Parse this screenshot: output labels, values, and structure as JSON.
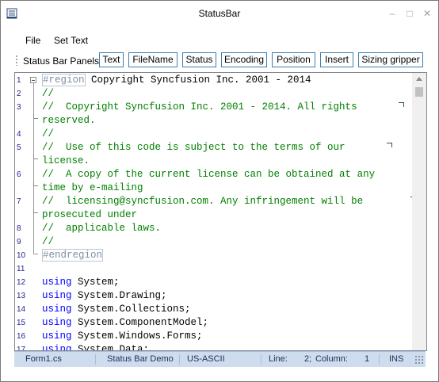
{
  "window": {
    "title": "StatusBar",
    "app_icon": "window-icon"
  },
  "window_buttons": {
    "minimize": "–",
    "maximize": "□",
    "close": "✕"
  },
  "menu": {
    "file": "File",
    "set_text": "Set Text"
  },
  "toolbar": {
    "label": "Status Bar Panels:",
    "buttons": [
      "Text",
      "FileName",
      "Status",
      "Encoding",
      "Position",
      "Insert",
      "Sizing gripper"
    ]
  },
  "editor": {
    "line_numbers": [
      "1",
      "2",
      "3",
      "",
      "4",
      "5",
      "",
      "6",
      "",
      "7",
      "",
      "8",
      "9",
      "10",
      "",
      "11",
      "12",
      "13",
      "14",
      "15",
      "16",
      "17"
    ],
    "lines": [
      {
        "t": "#region",
        "rest": " Copyright Syncfusion Inc. 2001 - 2014"
      },
      {
        "c": "//"
      },
      {
        "c": "//  Copyright Syncfusion Inc. 2001 - 2014. All rights"
      },
      {
        "c": "reserved."
      },
      {
        "c": "//"
      },
      {
        "c": "//  Use of this code is subject to the terms of our"
      },
      {
        "c": "license."
      },
      {
        "c": "//  A copy of the current license can be obtained at any"
      },
      {
        "c": "time by e-mailing"
      },
      {
        "c": "//  licensing@syncfusion.com. Any infringement will be"
      },
      {
        "c": "prosecuted under"
      },
      {
        "c": "//  applicable laws."
      },
      {
        "c": "//"
      },
      {
        "t": "#endregion"
      },
      {
        "e": ""
      },
      {
        "e": ""
      },
      {
        "k": "using",
        "rest": " System;"
      },
      {
        "k": "using",
        "rest": " System.Drawing;"
      },
      {
        "k": "using",
        "rest": " System.Collections;"
      },
      {
        "k": "using",
        "rest": " System.ComponentModel;"
      },
      {
        "k": "using",
        "rest": " System.Windows.Forms;"
      },
      {
        "k": "using",
        "rest": " System.Data;"
      }
    ]
  },
  "statusbar": {
    "filename": "Form1.cs",
    "text": "Status Bar Demo",
    "encoding": "US-ASCII",
    "line_label": "Line:",
    "line_value": "2;",
    "column_label": "Column:",
    "column_value": "1",
    "insert": "INS"
  }
}
